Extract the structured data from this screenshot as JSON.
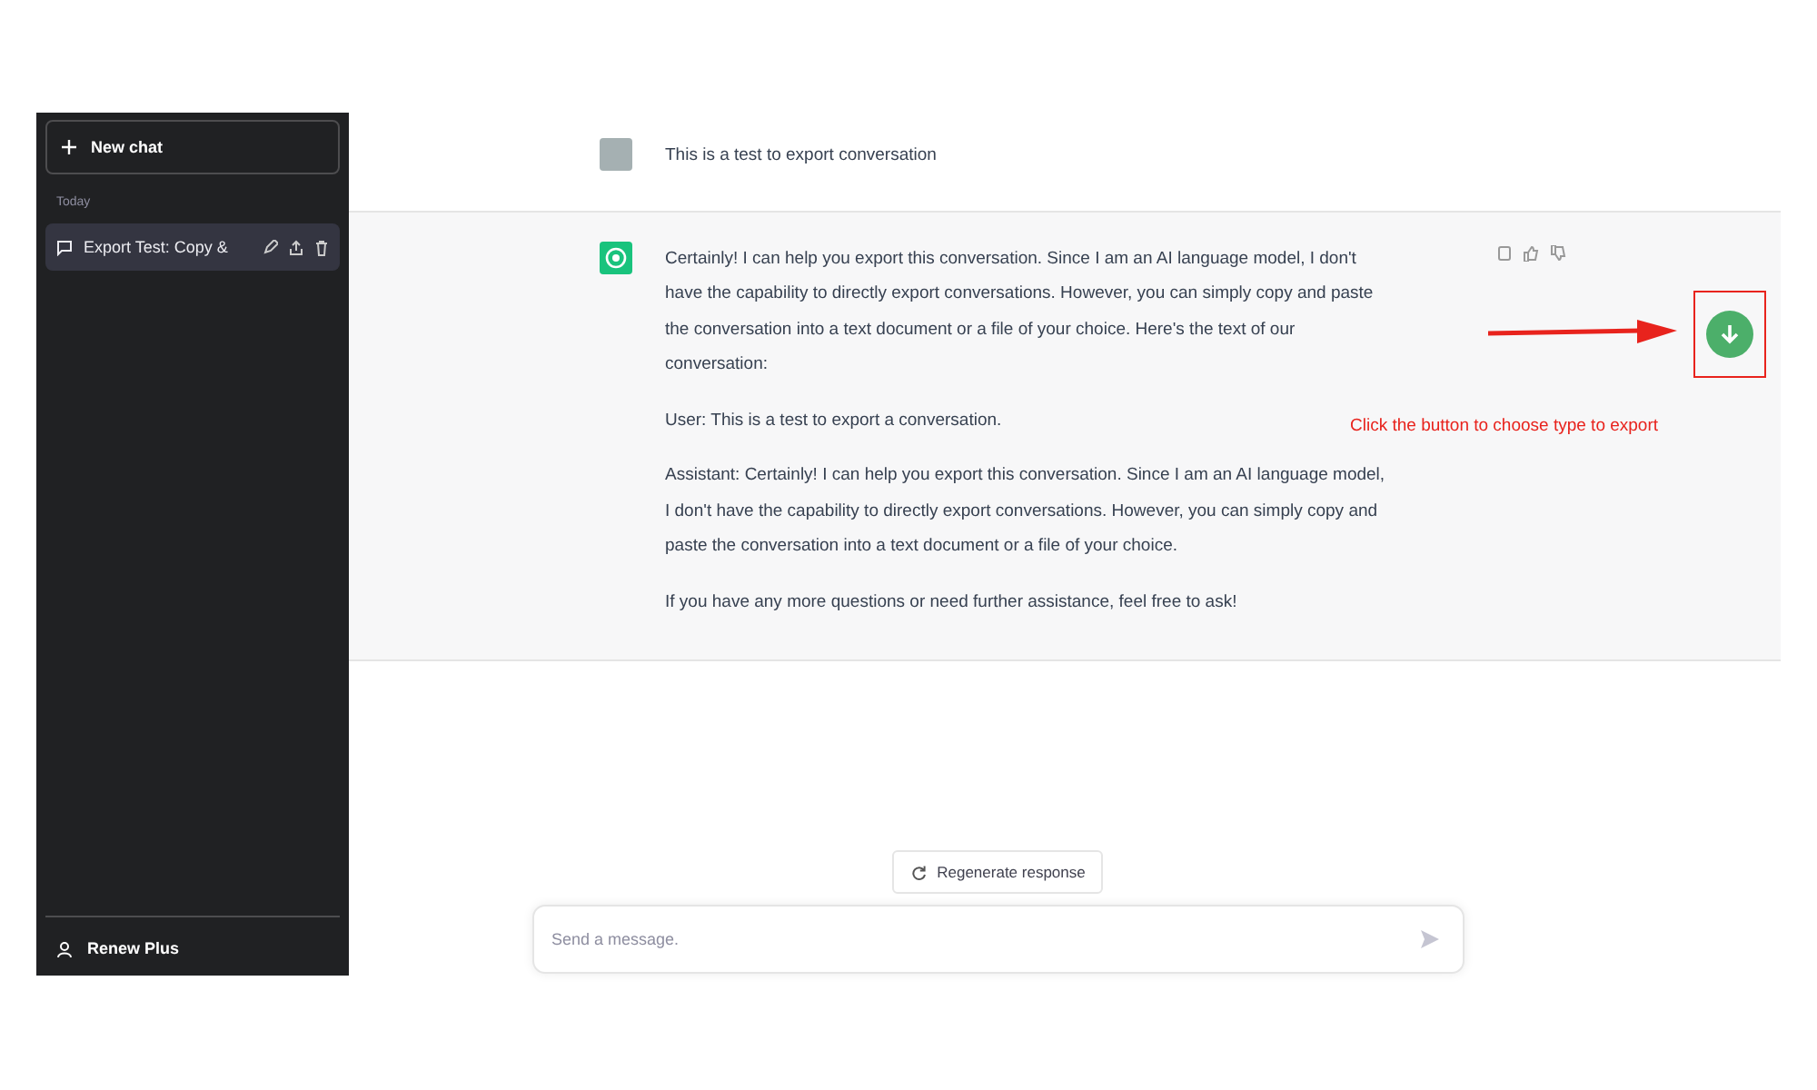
{
  "sidebar": {
    "new_chat_button": "New chat",
    "section_label": "Today",
    "conversations": [
      {
        "title": "Export Test: Copy &",
        "selected": true
      }
    ],
    "account": "Renew Plus"
  },
  "messages": [
    {
      "kind": "user",
      "paragraphs": [
        "This is a  test to export  conversation"
      ]
    },
    {
      "kind": "assistant",
      "paragraphs": [
        "Certainly! I can help you export this conversation. Since I am an AI language model, I don't have the capability to directly export conversations. However, you can simply copy and paste the conversation into a text document or a file of your choice. Here's the text of our conversation:",
        "User: This is a test to export a conversation.",
        "Assistant: Certainly! I can help you export this conversation. Since I am an AI language model, I don't have the capability to directly export conversations. However, you can simply copy and paste the conversation into a text document or a file of your choice.",
        "If you have any more questions or need further assistance, feel free to ask!"
      ]
    }
  ],
  "regenerate_button": "Regenerate response",
  "composer": {
    "placeholder": "Send a message."
  },
  "annotation": {
    "text": "Click the button to choose type to export"
  }
}
